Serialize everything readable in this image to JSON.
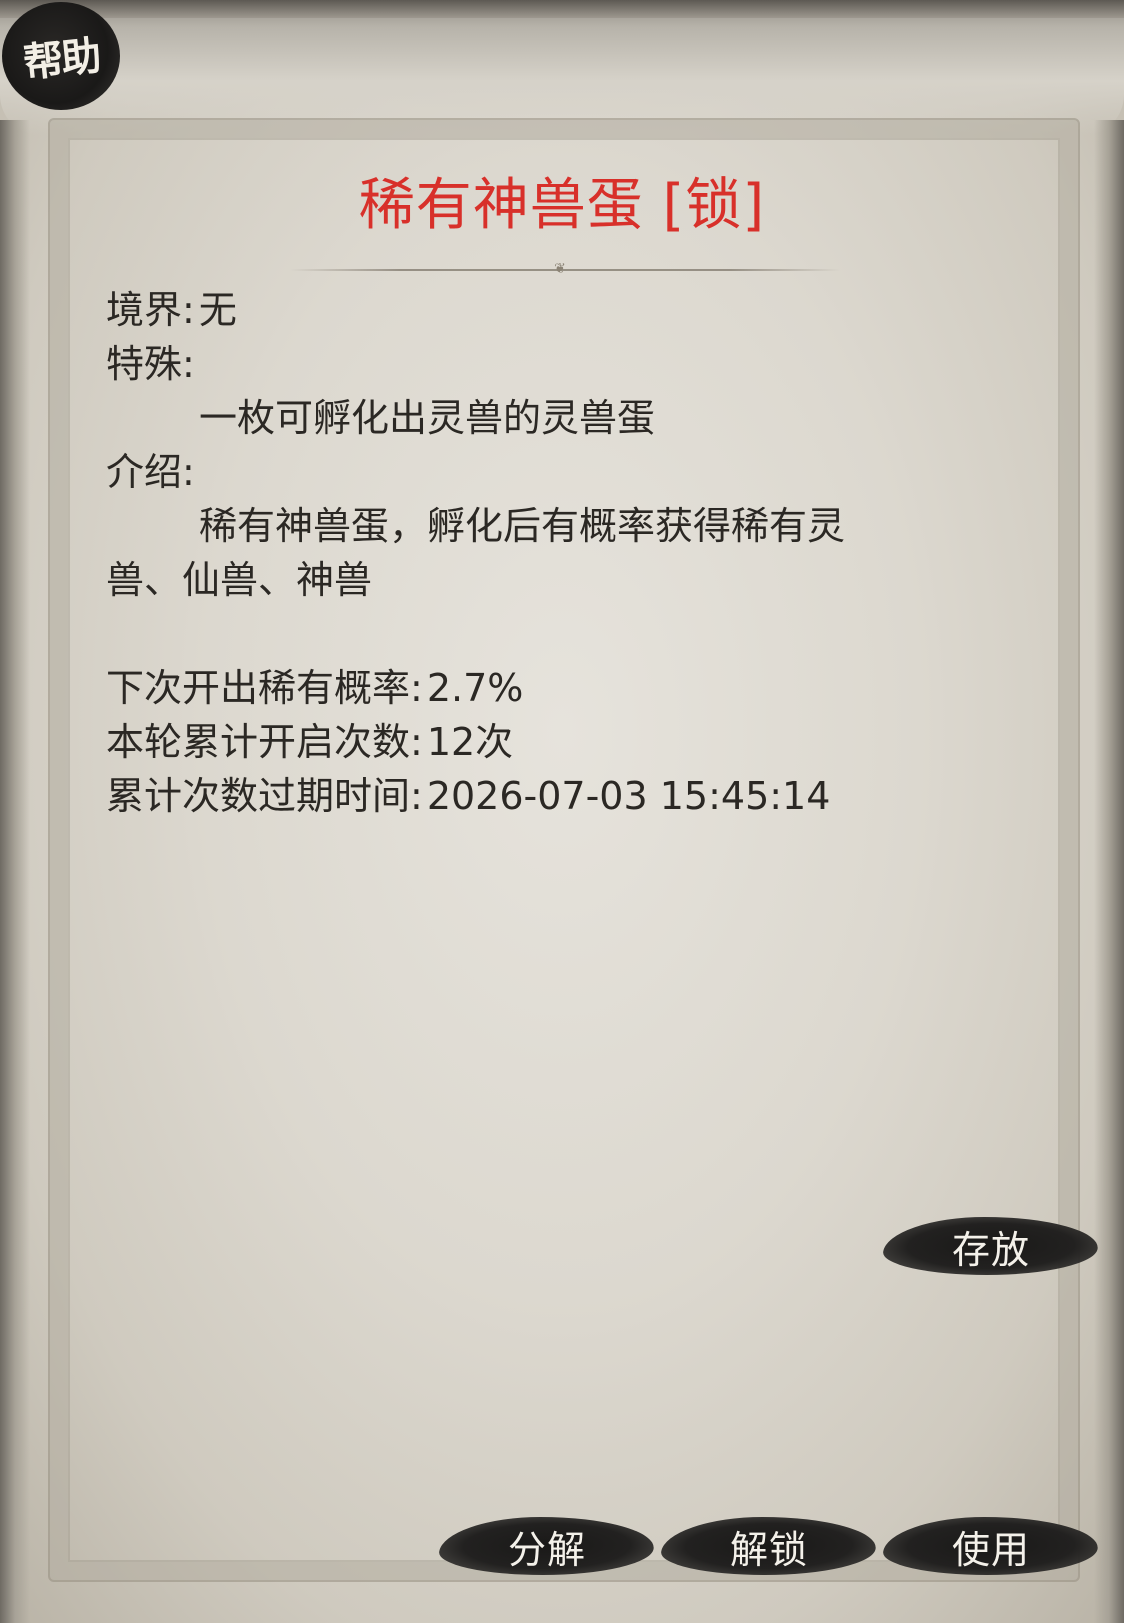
{
  "help_badge": {
    "label": "帮助"
  },
  "item": {
    "title": "稀有神兽蛋 [锁]",
    "title_color": "#d8302a"
  },
  "details": {
    "realm_label": "境界:",
    "realm_value": "无",
    "special_label": "特殊:",
    "special_text": "一枚可孵化出灵兽的灵兽蛋",
    "intro_label": "介绍:",
    "intro_line1": "稀有神兽蛋，孵化后有概率获得稀有灵",
    "intro_line2": "兽、仙兽、神兽",
    "next_rare_label": "下次开出稀有概率:",
    "next_rare_value": "2.7%",
    "open_count_label": "本轮累计开启次数:",
    "open_count_value": "12次",
    "expire_label": "累计次数过期时间:",
    "expire_value": "2026-07-03 15:45:14"
  },
  "buttons": {
    "store": "存放",
    "decompose": "分解",
    "unlock": "解锁",
    "use": "使用"
  }
}
